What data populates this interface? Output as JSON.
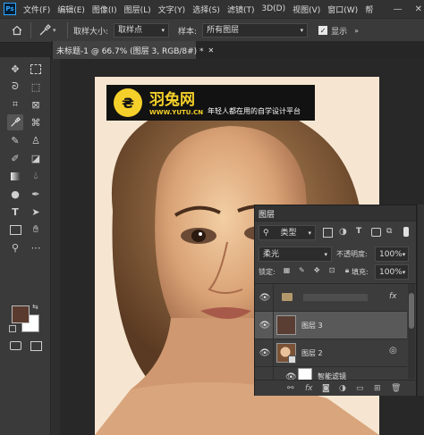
{
  "menubar": {
    "items": [
      "文件(F)",
      "编辑(E)",
      "图像(I)",
      "图层(L)",
      "文字(Y)",
      "选择(S)",
      "滤镜(T)",
      "3D(D)",
      "视图(V)",
      "窗口(W)",
      "帮"
    ],
    "logo": "Ps",
    "minimize": "—",
    "close": "✕"
  },
  "options": {
    "sample_size_label": "取样大小:",
    "sample_size_value": "取样点",
    "sample_label": "样本:",
    "sample_value": "所有图层",
    "show_ring_label": "显示"
  },
  "document": {
    "tab_title": "未标题-1 @ 66.7% (图层 3, RGB/8#) *"
  },
  "banner": {
    "brand": "羽兔网",
    "url": "WWW.YUTU.CN",
    "slogan": "年轻人都在用的自学设计平台"
  },
  "layers_panel": {
    "title": "图层",
    "filter_kind": "类型",
    "blend_mode": "柔光",
    "opacity_label": "不透明度:",
    "opacity_value": "100%",
    "lock_label": "锁定:",
    "fill_label": "填充:",
    "fill_value": "100%",
    "fx_badge": "fx",
    "layers": [
      {
        "name": "",
        "type": "group"
      },
      {
        "name": "图层 3",
        "type": "fill"
      },
      {
        "name": "图层 2",
        "type": "smart-object"
      },
      {
        "name": "智能滤镜",
        "type": "smart-filter"
      }
    ]
  },
  "colors": {
    "foreground": "#5a3a2e",
    "background": "#ffffff",
    "selected_layer": "#595959",
    "layer3_thumb": "#5a3e33",
    "banner_bg": "#121212",
    "accent_yellow": "#f5d02a"
  }
}
